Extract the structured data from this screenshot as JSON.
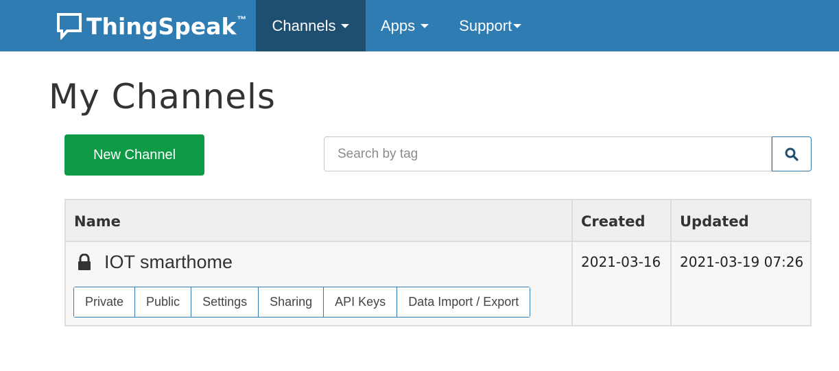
{
  "brand": {
    "name": "ThingSpeak",
    "tm": "™"
  },
  "nav": {
    "items": [
      {
        "label": "Channels",
        "active": true
      },
      {
        "label": "Apps",
        "active": false
      },
      {
        "label": "Support",
        "active": false
      }
    ]
  },
  "page": {
    "title": "My Channels"
  },
  "toolbar": {
    "new_channel_label": "New Channel"
  },
  "search": {
    "placeholder": "Search by tag",
    "value": ""
  },
  "table": {
    "headers": [
      "Name",
      "Created",
      "Updated"
    ],
    "rows": [
      {
        "name": "IOT smarthome",
        "created": "2021-03-16",
        "updated": "2021-03-19 07:26",
        "actions": [
          "Private",
          "Public",
          "Settings",
          "Sharing",
          "API Keys",
          "Data Import / Export"
        ]
      }
    ]
  },
  "colors": {
    "navbar": "#2e7cb2",
    "nav_active": "#1e4e70",
    "new_channel_button": "#0f9b46",
    "table_header_bg": "#efefef",
    "table_row_bg": "#f7f7f7"
  },
  "icons": {
    "brand": "speech-bubble-icon",
    "search": "search-icon",
    "lock": "lock-icon",
    "caret": "caret-down-icon"
  }
}
